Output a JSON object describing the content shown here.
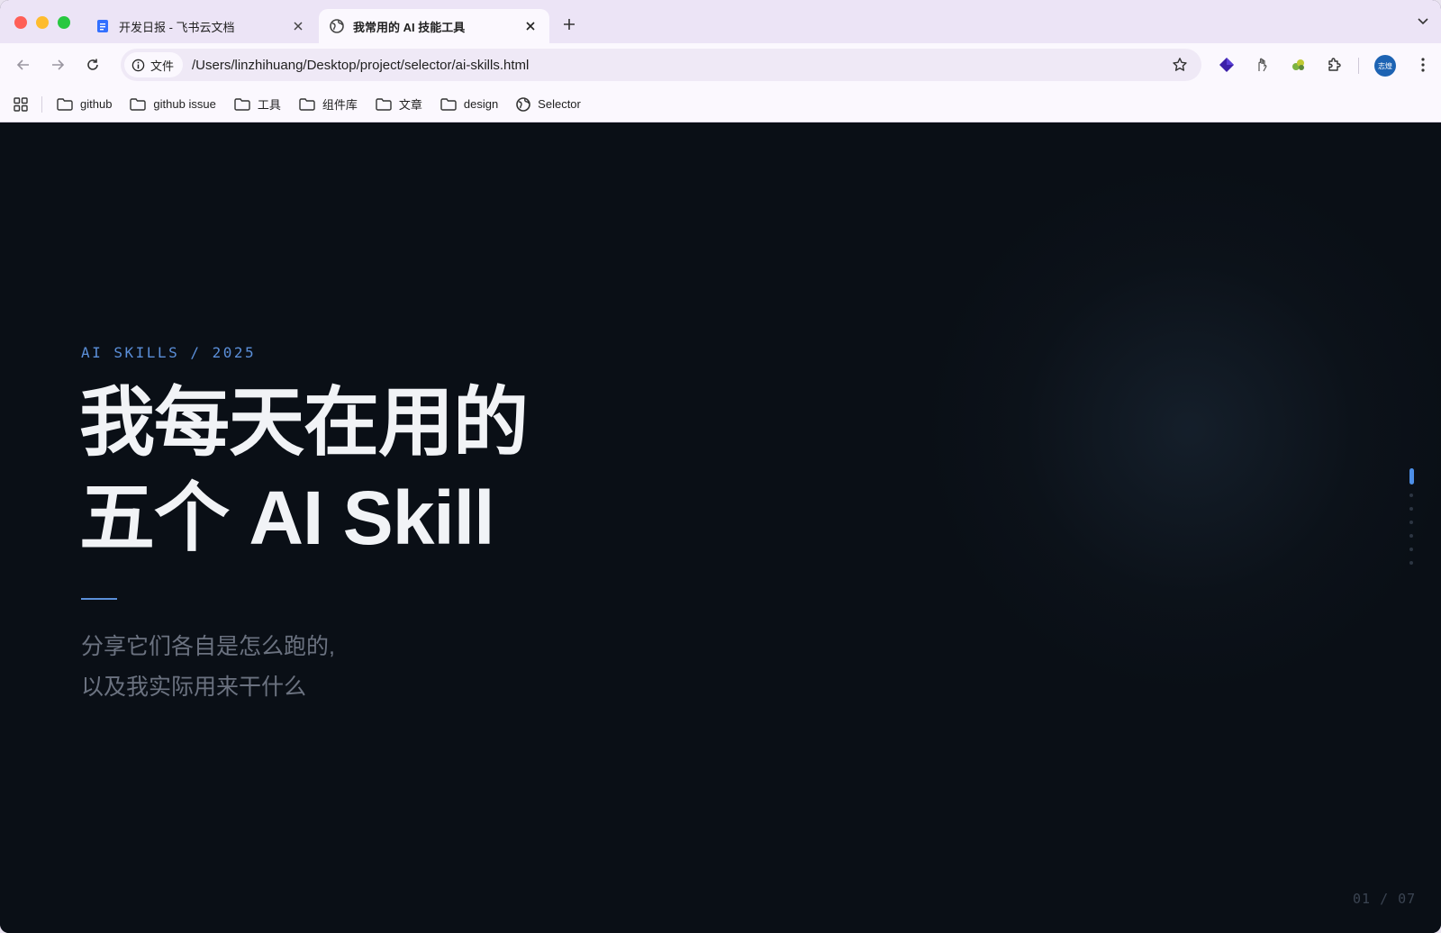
{
  "browser": {
    "tabs": [
      {
        "title": "开发日报 - 飞书云文档",
        "active": false,
        "favicon": "doc-icon"
      },
      {
        "title": "我常用的 AI 技能工具",
        "active": true,
        "favicon": "globe-icon"
      }
    ],
    "address": {
      "scheme_chip": "文件",
      "url": "/Users/linzhihuang/Desktop/project/selector/ai-skills.html"
    },
    "profile_initials": "志煌",
    "bookmarks": [
      {
        "label": "github",
        "icon": "folder-icon"
      },
      {
        "label": "github issue",
        "icon": "folder-icon"
      },
      {
        "label": "工具",
        "icon": "folder-icon"
      },
      {
        "label": "组件库",
        "icon": "folder-icon"
      },
      {
        "label": "文章",
        "icon": "folder-icon"
      },
      {
        "label": "design",
        "icon": "folder-icon"
      },
      {
        "label": "Selector",
        "icon": "globe-icon"
      }
    ]
  },
  "slide": {
    "eyebrow": "AI SKILLS / 2025",
    "title_line1": "我每天在用的",
    "title_line2": "五个 AI Skill",
    "subtitle_line1": "分享它们各自是怎么跑的,",
    "subtitle_line2": "以及我实际用来干什么",
    "pager": "01 / 07",
    "current_index": 1,
    "total": 7
  },
  "colors": {
    "page_bg": "#0a0f16",
    "accent": "#5b8fd9",
    "title_text": "#f1f3f6",
    "subtitle_text": "#6b7280"
  }
}
